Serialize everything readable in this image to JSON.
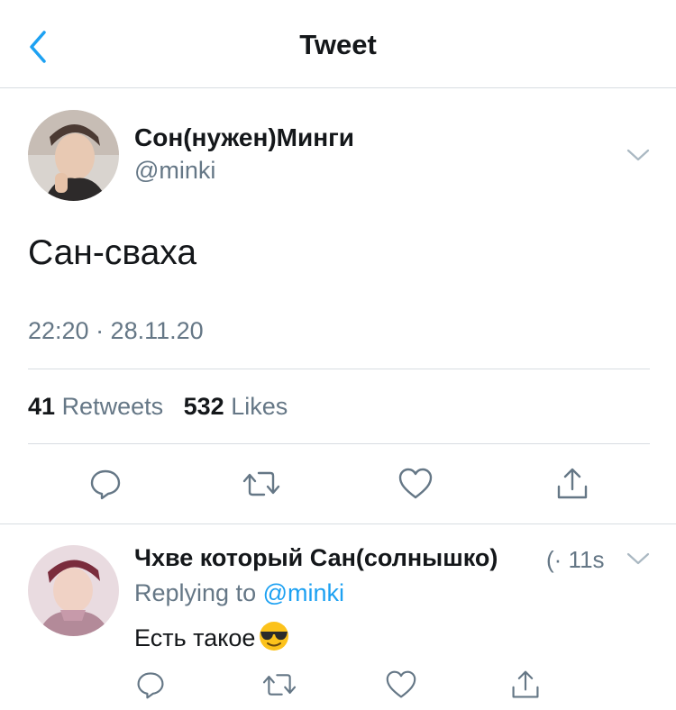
{
  "header": {
    "title": "Tweet",
    "back_icon": "chevron-left-icon"
  },
  "main_tweet": {
    "display_name": "Сон(нужен)Минги",
    "handle": "@minki",
    "text": "Сан-сваха",
    "timestamp": "22:20 · 28.11.20",
    "stats": {
      "retweets_count": "41",
      "retweets_label": "Retweets",
      "likes_count": "532",
      "likes_label": "Likes"
    },
    "actions": [
      "reply-icon",
      "retweet-icon",
      "like-icon",
      "share-icon"
    ]
  },
  "reply": {
    "display_name": "Чхве который Сан(солнышко)",
    "meta": "(· 11s",
    "replying_prefix": "Replying to",
    "replying_to": "@minki",
    "text": "Есть такое",
    "emoji": "sunglasses-emoji",
    "actions": [
      "reply-icon",
      "retweet-icon",
      "like-icon",
      "share-icon"
    ]
  },
  "colors": {
    "accent": "#1da1f2",
    "secondary_text": "#657786",
    "primary_text": "#14171a",
    "divider": "#d8dde2"
  }
}
